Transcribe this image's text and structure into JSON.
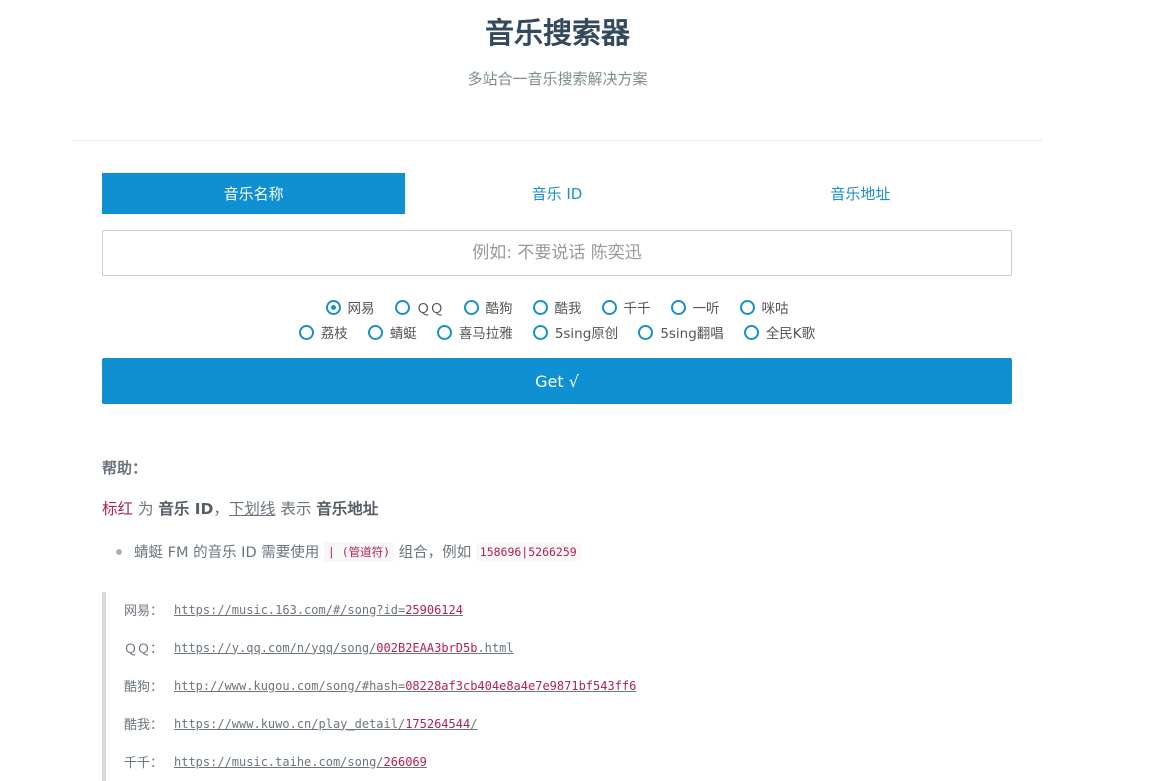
{
  "header": {
    "title": "音乐搜索器",
    "subtitle": "多站合一音乐搜索解决方案"
  },
  "tabs": [
    {
      "label": "音乐名称",
      "active": true
    },
    {
      "label": "音乐 ID",
      "active": false
    },
    {
      "label": "音乐地址",
      "active": false
    }
  ],
  "search": {
    "placeholder": "例如: 不要说话 陈奕迅",
    "value": ""
  },
  "sources_row1": [
    {
      "label": "网易",
      "checked": true
    },
    {
      "label": "ＱＱ",
      "checked": false
    },
    {
      "label": "酷狗",
      "checked": false
    },
    {
      "label": "酷我",
      "checked": false
    },
    {
      "label": "千千",
      "checked": false
    },
    {
      "label": "一听",
      "checked": false
    },
    {
      "label": "咪咕",
      "checked": false
    }
  ],
  "sources_row2": [
    {
      "label": "荔枝",
      "checked": false
    },
    {
      "label": "蜻蜓",
      "checked": false
    },
    {
      "label": "喜马拉雅",
      "checked": false
    },
    {
      "label": "5sing原创",
      "checked": false
    },
    {
      "label": "5sing翻唱",
      "checked": false
    },
    {
      "label": "全民K歌",
      "checked": false
    }
  ],
  "get_button": "Get √",
  "help": {
    "title": "帮助：",
    "legend": {
      "red_text": "标红",
      "is": " 为 ",
      "music_id": "音乐 ID",
      "comma": "，",
      "underline_text": "下划线",
      "means": " 表示 ",
      "music_url": "音乐地址"
    },
    "note": {
      "prefix": "蜻蜓 FM 的音乐 ID 需要使用 ",
      "pipe_code": "| (管道符)",
      "middle": " 组合，例如 ",
      "example_code": "158696|5266259"
    },
    "examples": [
      {
        "label": "网易：",
        "url_pre": "https://music.163.com/#/song?id=",
        "id": "25906124",
        "url_post": ""
      },
      {
        "label": "ＱＱ：",
        "url_pre": "https://y.qq.com/n/yqq/song/",
        "id": "002B2EAA3brD5b",
        "url_post": ".html"
      },
      {
        "label": "酷狗：",
        "url_pre": "http://www.kugou.com/song/#hash=",
        "id": "08228af3cb404e8a4e7e9871bf543ff6",
        "url_post": ""
      },
      {
        "label": "酷我：",
        "url_pre": "https://www.kuwo.cn/play_detail/",
        "id": "175264544",
        "url_post": "/"
      },
      {
        "label": "千千：",
        "url_pre": "https://music.taihe.com/song/",
        "id": "266069",
        "url_post": ""
      }
    ]
  },
  "colors": {
    "primary": "#0e90d2",
    "link": "#1a8fc9",
    "highlight_red": "#b0224b",
    "title": "#34495e"
  }
}
